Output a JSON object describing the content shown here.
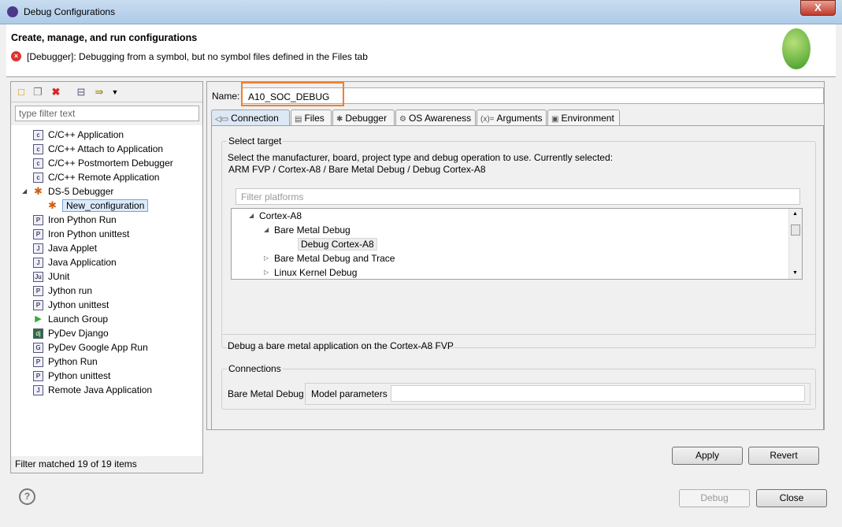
{
  "window": {
    "title": "Debug Configurations",
    "close": "X"
  },
  "header": {
    "title": "Create, manage, and run configurations",
    "error": "[Debugger]: Debugging from a symbol, but no symbol files defined in the Files tab"
  },
  "left": {
    "filter_placeholder": "type filter text",
    "items": [
      {
        "label": "C/C++ Application",
        "icon": "c-app-icon",
        "glyph": "c"
      },
      {
        "label": "C/C++ Attach to Application",
        "icon": "c-app-icon",
        "glyph": "c"
      },
      {
        "label": "C/C++ Postmortem Debugger",
        "icon": "c-app-icon",
        "glyph": "c"
      },
      {
        "label": "C/C++ Remote Application",
        "icon": "c-app-icon",
        "glyph": "c"
      },
      {
        "label": "DS-5 Debugger",
        "icon": "bug-icon",
        "glyph": "✱"
      },
      {
        "label": "New_configuration",
        "icon": "bug-icon",
        "glyph": "✱"
      },
      {
        "label": "Iron Python Run",
        "icon": "python-icon",
        "glyph": "P"
      },
      {
        "label": "Iron Python unittest",
        "icon": "python-icon",
        "glyph": "P"
      },
      {
        "label": "Java Applet",
        "icon": "java-icon",
        "glyph": "J"
      },
      {
        "label": "Java Application",
        "icon": "java-icon",
        "glyph": "J"
      },
      {
        "label": "JUnit",
        "icon": "junit-icon",
        "glyph": "Ju"
      },
      {
        "label": "Jython run",
        "icon": "python-icon",
        "glyph": "P"
      },
      {
        "label": "Jython unittest",
        "icon": "python-icon",
        "glyph": "P"
      },
      {
        "label": "Launch Group",
        "icon": "play-icon",
        "glyph": "▶"
      },
      {
        "label": "PyDev Django",
        "icon": "django-icon",
        "glyph": "dj"
      },
      {
        "label": "PyDev Google App Run",
        "icon": "google-app-icon",
        "glyph": "G"
      },
      {
        "label": "Python Run",
        "icon": "python-icon",
        "glyph": "P"
      },
      {
        "label": "Python unittest",
        "icon": "python-icon",
        "glyph": "P"
      },
      {
        "label": "Remote Java Application",
        "icon": "java-icon",
        "glyph": "J"
      }
    ],
    "footer": "Filter matched 19 of 19 items"
  },
  "right": {
    "name_label": "Name:",
    "name_value": "A10_SOC_DEBUG",
    "tabs": [
      {
        "label": "Connection",
        "glyph": "◁▭"
      },
      {
        "label": "Files",
        "glyph": "▤"
      },
      {
        "label": "Debugger",
        "glyph": "✱"
      },
      {
        "label": "OS Awareness",
        "glyph": "⚙"
      },
      {
        "label": "Arguments",
        "glyph": "(x)="
      },
      {
        "label": "Environment",
        "glyph": "▣"
      }
    ],
    "select_target": {
      "label": "Select target",
      "desc": "Select the manufacturer, board, project type and debug operation to use. Currently selected:",
      "current": "ARM FVP / Cortex-A8 / Bare Metal Debug / Debug Cortex-A8",
      "filter_placeholder": "Filter platforms",
      "tree": [
        {
          "label": "Cortex-A8",
          "exp": "◢"
        },
        {
          "label": "Bare Metal Debug",
          "exp": "◢"
        },
        {
          "label": "Debug Cortex-A8",
          "exp": ""
        },
        {
          "label": "Bare Metal Debug and Trace",
          "exp": "▷"
        },
        {
          "label": "Linux Kernel Debug",
          "exp": "▷"
        }
      ],
      "info": "Debug a bare metal application on the Cortex-A8 FVP"
    },
    "connections": {
      "label": "Connections",
      "bare_metal": "Bare Metal Debug",
      "model_params": "Model parameters",
      "model_value": ""
    },
    "apply": "Apply",
    "revert": "Revert"
  },
  "footer": {
    "debug": "Debug",
    "close": "Close",
    "help": "?"
  }
}
